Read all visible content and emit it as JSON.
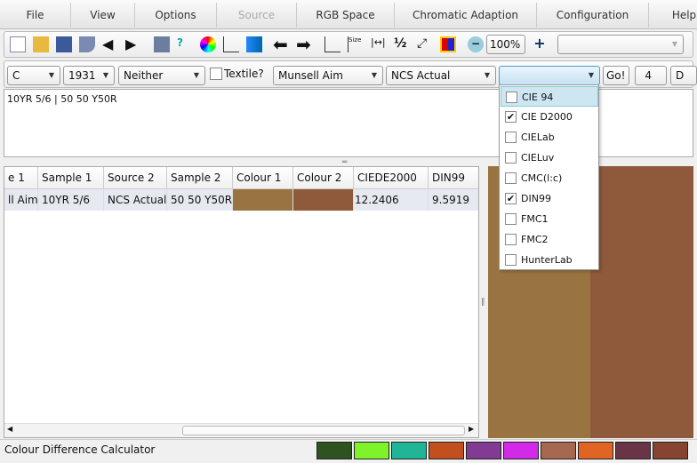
{
  "menu": [
    "File",
    "View",
    "Options",
    "Source",
    "RGB Space",
    "Chromatic Adaption",
    "Configuration",
    "Help"
  ],
  "toolbar": {
    "zoom": "100%",
    "icons": [
      "new-icon",
      "open-icon",
      "save-icon",
      "close-file-icon",
      "import-icon",
      "export-icon",
      "book-icon",
      "help-icon",
      "color-wheel-icon",
      "chart-icon",
      "gradient-icon",
      "back-icon",
      "forward-icon",
      "swap-icon",
      "size-icon",
      "fit-width-icon",
      "half-icon",
      "fullscreen-icon",
      "compare-icon",
      "zoom-out-icon",
      "zoom-in-icon"
    ]
  },
  "row2": {
    "illuminant": "C",
    "observer": "1931",
    "mode": "Neither",
    "textile_label": "Textile?",
    "source1": "Munsell Aim",
    "source2": "NCS Actual",
    "metric": "",
    "go": "Go!",
    "precision": "4",
    "extra": "D"
  },
  "input_text": "10YR 5/6 | 50 50 Y50R",
  "table": {
    "headers": [
      "e 1",
      "Sample 1",
      "Source 2",
      "Sample 2",
      "Colour 1",
      "Colour 2",
      "CIEDE2000",
      "DIN99"
    ],
    "row": [
      "ll Aim",
      "10YR 5/6",
      "NCS Actual",
      "50 50 Y50R",
      "",
      "",
      "12.2406",
      "9.5919"
    ]
  },
  "colours": {
    "colour1": "#9a7440",
    "colour2": "#8f5a3b"
  },
  "dropdown": [
    {
      "label": "CIE 94",
      "checked": false
    },
    {
      "label": "CIE D2000",
      "checked": true
    },
    {
      "label": "CIELab",
      "checked": false
    },
    {
      "label": "CIELuv",
      "checked": false
    },
    {
      "label": "CMC(l:c)",
      "checked": false
    },
    {
      "label": "DIN99",
      "checked": true
    },
    {
      "label": "FMC1",
      "checked": false
    },
    {
      "label": "FMC2",
      "checked": false
    },
    {
      "label": "HunterLab",
      "checked": false
    }
  ],
  "status": "Colour Difference Calculator",
  "swatches": [
    "#2f5320",
    "#7ef32a",
    "#1fb596",
    "#c24f1e",
    "#823b93",
    "#d22ae8",
    "#a66850",
    "#e06423",
    "#6a3447",
    "#874431"
  ]
}
